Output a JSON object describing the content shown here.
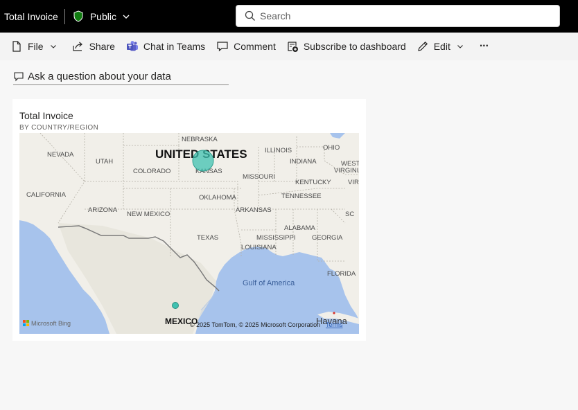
{
  "topbar": {
    "report_title": "Total Invoice",
    "sensitivity_label": "Public",
    "search_placeholder": "Search"
  },
  "actions": {
    "file": "File",
    "share": "Share",
    "chat_in_teams": "Chat in Teams",
    "comment": "Comment",
    "subscribe": "Subscribe to dashboard",
    "edit": "Edit",
    "more": "···"
  },
  "qna": {
    "prompt": "Ask a question about your data"
  },
  "tile": {
    "title": "Total Invoice",
    "subtitle": "BY COUNTRY/REGION",
    "map": {
      "country_labels": [
        "UNITED STATES",
        "MEXICO"
      ],
      "state_labels": [
        "NEBRASKA",
        "NEVADA",
        "UTAH",
        "COLORADO",
        "KANSAS",
        "ILLINOIS",
        "OHIO",
        "INDIANA",
        "WEST VIRGINIA",
        "CALIFORNIA",
        "MISSOURI",
        "KENTUCKY",
        "VIR",
        "OKLAHOMA",
        "TENNESSEE",
        "ARIZONA",
        "NEW MEXICO",
        "ARKANSAS",
        "SC",
        "ALABAMA",
        "TEXAS",
        "MISSISSIPPI",
        "GEORGIA",
        "LOUISIANA",
        "FLORIDA"
      ],
      "water_label": "Gulf of America",
      "city_label": "Havana",
      "copyright": "© 2025 TomTom, © 2025 Microsoft Corporation",
      "terms": "Terms",
      "provider": "Microsoft Bing",
      "bubbles": [
        {
          "location": "United States"
        },
        {
          "location": "Mexico"
        }
      ],
      "bubble_color": "#3fc1b0"
    }
  }
}
